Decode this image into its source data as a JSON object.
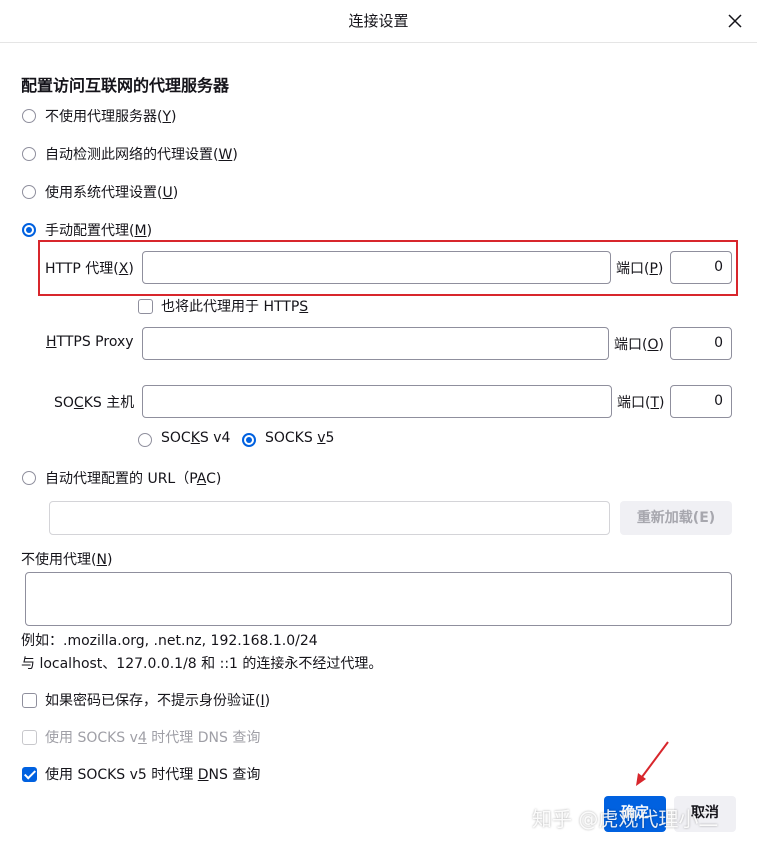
{
  "window": {
    "title": "连接设置",
    "close_icon": "close-icon"
  },
  "heading": "配置访问互联网的代理服务器",
  "proxy_modes": [
    {
      "label": "不使用代理服务器(",
      "key": "Y",
      "suffix": ")",
      "checked": false
    },
    {
      "label": "自动检测此网络的代理设置(",
      "key": "W",
      "suffix": ")",
      "checked": false
    },
    {
      "label": "使用系统代理设置(",
      "key": "U",
      "suffix": ")",
      "checked": false
    },
    {
      "label": "手动配置代理(",
      "key": "M",
      "suffix": ")",
      "checked": true
    }
  ],
  "manual": {
    "http_label_pre": "HTTP 代理(",
    "http_label_key": "X",
    "http_label_suf": ")",
    "http_value": "",
    "http_port_label_pre": "端口(",
    "http_port_label_key": "P",
    "http_port_label_suf": ")",
    "http_port": "0",
    "also_https_pre": "也将此代理用于 HTTP",
    "also_https_key": "S",
    "also_https_checked": false,
    "https_label_key": "H",
    "https_label_rest": "TTPS Proxy",
    "https_value": "",
    "https_port_label_pre": "端口(",
    "https_port_label_key": "O",
    "https_port_label_suf": ")",
    "https_port": "0",
    "socks_label_pre": "SO",
    "socks_label_key": "C",
    "socks_label_rest": "KS 主机",
    "socks_value": "",
    "socks_port_label_pre": "端口(",
    "socks_port_label_key": "T",
    "socks_port_label_suf": ")",
    "socks_port": "0",
    "socks_v4_pre": "SOC",
    "socks_v4_key": "K",
    "socks_v4_rest": "S v4",
    "socks_v4_checked": false,
    "socks_v5_pre": "SOCKS ",
    "socks_v5_key": "v",
    "socks_v5_rest": "5",
    "socks_v5_checked": true
  },
  "pac": {
    "label_pre": "自动代理配置的 URL（P",
    "label_key": "A",
    "label_suf": "C)",
    "checked": false,
    "value": "",
    "reload_label": "重新加载(E)"
  },
  "no_proxy": {
    "label_pre": "不使用代理(",
    "label_key": "N",
    "label_suf": ")",
    "value": "",
    "example": "例如：.mozilla.org, .net.nz, 192.168.1.0/24",
    "note": "与 localhost、127.0.0.1/8 和 ::1 的连接永不经过代理。"
  },
  "options": [
    {
      "label_pre": "如果密码已保存，不提示身份验证(",
      "label_key": "I",
      "label_suf": ")",
      "checked": false,
      "disabled": false
    },
    {
      "label_pre": "使用 SOCKS v",
      "label_key": "4",
      "label_suf": " 时代理 DNS 查询",
      "checked": false,
      "disabled": true
    },
    {
      "label_pre": "使用 SOCKS v5 时代理 ",
      "label_key": "D",
      "label_suf": "NS 查询",
      "checked": true,
      "disabled": false
    }
  ],
  "buttons": {
    "ok": "确定",
    "cancel": "取消"
  },
  "watermark": "知乎 @虎观代理小二",
  "colors": {
    "accent": "#0061e0",
    "highlight": "#d8262c",
    "arrow": "#d8262c"
  }
}
